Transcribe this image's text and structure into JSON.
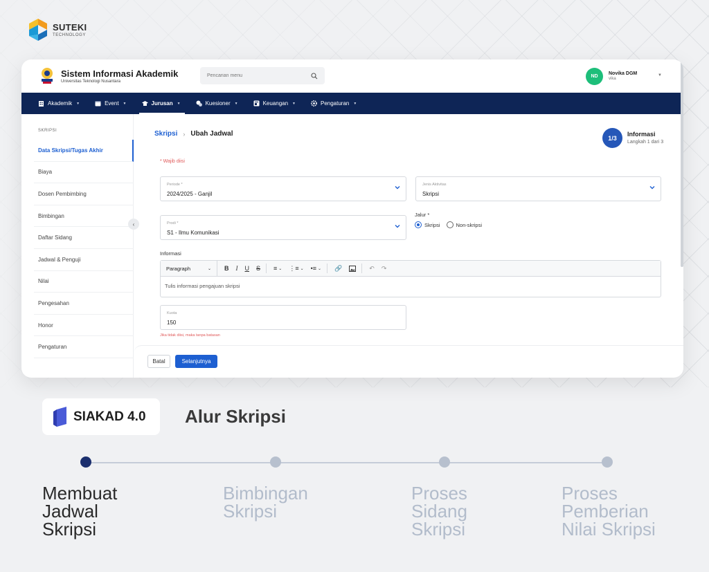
{
  "brand": {
    "name": "SUTEKI",
    "sub": "TECHNOLOGY"
  },
  "app": {
    "title": "Sistem Informasi Akademik",
    "subtitle": "Universitas Teknologi Nusantara",
    "search_placeholder": "Pencarian menu",
    "user": {
      "initials": "ND",
      "name": "Novika DGM",
      "role": "vika"
    }
  },
  "nav": [
    {
      "label": "Akademik",
      "icon": "building-icon"
    },
    {
      "label": "Event",
      "icon": "calendar-icon"
    },
    {
      "label": "Jurusan",
      "icon": "graduation-cap-icon",
      "active": true
    },
    {
      "label": "Kuesioner",
      "icon": "questionnaire-icon"
    },
    {
      "label": "Keuangan",
      "icon": "finance-icon"
    },
    {
      "label": "Pengaturan",
      "icon": "gear-icon"
    }
  ],
  "sidebar": {
    "heading": "SKRIPSI",
    "items": [
      "Data Skripsi/Tugas Akhir",
      "Biaya",
      "Dosen Pembimbing",
      "Bimbingan",
      "Daftar Sidang",
      "Jadwal & Penguji",
      "Nilai",
      "Pengesahan",
      "Honor",
      "Pengaturan"
    ]
  },
  "breadcrumb": {
    "parent": "Skripsi",
    "current": "Ubah Jadwal"
  },
  "step": {
    "counter": "1/3",
    "title": "Informasi",
    "sub": "Langkah 1 dari 3"
  },
  "form": {
    "required_note": "* Wajib diisi",
    "periode": {
      "label": "Periode *",
      "value": "2024/2025 - Ganjil"
    },
    "jenis": {
      "label": "Jenis Aktivitas",
      "value": "Skripsi"
    },
    "prodi": {
      "label": "Prodi *",
      "value": "S1 - Ilmu Komunikasi"
    },
    "jalur": {
      "label": "Jalur *",
      "options": [
        "Skripsi",
        "Non-skripsi"
      ],
      "selected": "Skripsi"
    },
    "informasi": {
      "label": "Informasi",
      "paragraph": "Paragraph",
      "placeholder": "Tulis informasi pengajuan skripsi"
    },
    "kuota": {
      "label": "Kuota",
      "value": "150",
      "hint": "Jika tidak diisi, maka tanpa batasan"
    }
  },
  "buttons": {
    "cancel": "Batal",
    "next": "Selanjutnya"
  },
  "bottom": {
    "product": "SIAKAD 4.0",
    "title": "Alur Skripsi",
    "steps": [
      {
        "label_lines": [
          "Membuat",
          "Jadwal",
          "Skripsi"
        ],
        "active": true
      },
      {
        "label_lines": [
          "Bimbingan",
          "Skripsi"
        ],
        "active": false
      },
      {
        "label_lines": [
          "Proses",
          "Sidang",
          "Skripsi"
        ],
        "active": false
      },
      {
        "label_lines": [
          "Proses",
          "Pemberian",
          "Nilai Skripsi"
        ],
        "active": false
      }
    ]
  },
  "colors": {
    "navy": "#0e2556",
    "accent": "#1d5fd1",
    "active_dot": "#1b2f6e",
    "inactive_text": "#b2bccb"
  }
}
